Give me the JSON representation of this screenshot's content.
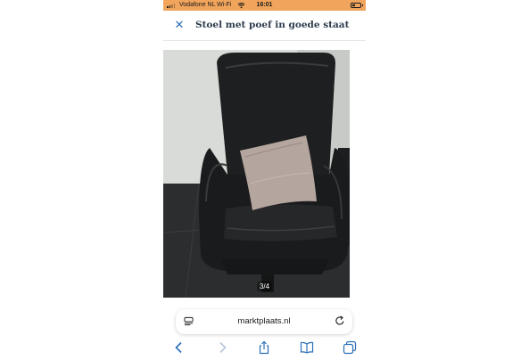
{
  "status_bar": {
    "carrier": "Vodafone NL Wi-Fi",
    "time": "16:01",
    "battery_level": 0.35,
    "background_color": "#f0a45c"
  },
  "header": {
    "close_icon": "close-icon",
    "title": "Stoel met poef in goede staat"
  },
  "gallery": {
    "counter": "3/4",
    "image_description_icon": "photo-black-leather-chair-with-pink-cushion"
  },
  "browser": {
    "url": "marktplaats.nl",
    "accent_color": "#2a6fb8",
    "toolbar": [
      "back-icon",
      "forward-icon",
      "share-icon",
      "bookmarks-icon",
      "tabs-icon"
    ]
  }
}
